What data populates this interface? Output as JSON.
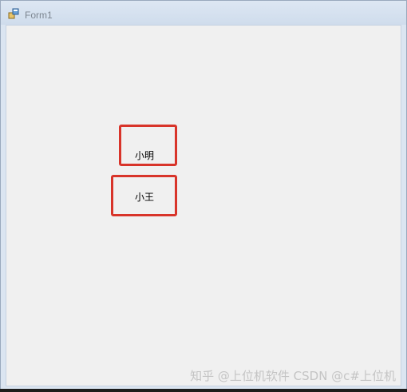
{
  "window": {
    "title": "Form1",
    "icon": "winforms-app-icon"
  },
  "labels": [
    {
      "text": "小明"
    },
    {
      "text": "小王"
    }
  ],
  "annotations": {
    "highlight_color": "#d8342a"
  },
  "watermark": "知乎 @上位机软件  CSDN @c#上位机"
}
